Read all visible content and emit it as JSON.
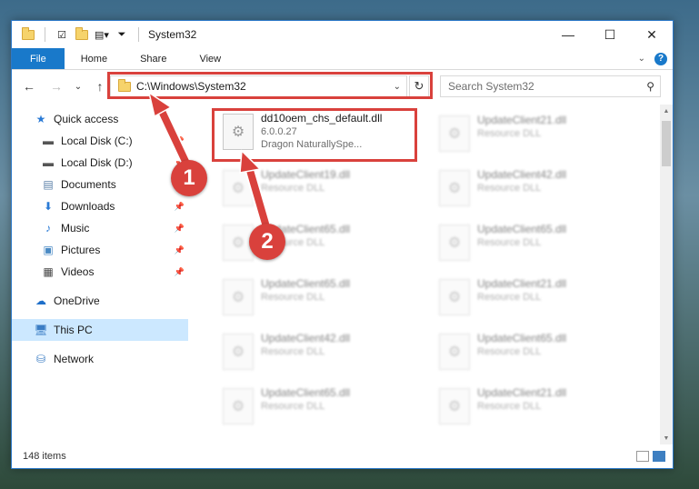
{
  "window": {
    "title": "System32",
    "controls": {
      "minimize": "—",
      "maximize": "☐",
      "close": "✕"
    }
  },
  "ribbon": {
    "tabs": [
      "File",
      "Home",
      "Share",
      "View"
    ],
    "help": "?"
  },
  "address": {
    "path": "C:\\Windows\\System32",
    "search_placeholder": "Search System32"
  },
  "sidebar": {
    "quick_access": "Quick access",
    "items": [
      {
        "label": "Local Disk (C:)",
        "icon": "drive-icon",
        "pinned": true
      },
      {
        "label": "Local Disk (D:)",
        "icon": "drive-icon",
        "pinned": true
      },
      {
        "label": "Documents",
        "icon": "documents-icon",
        "pinned": true
      },
      {
        "label": "Downloads",
        "icon": "downloads-icon",
        "pinned": true
      },
      {
        "label": "Music",
        "icon": "music-icon",
        "pinned": true
      },
      {
        "label": "Pictures",
        "icon": "pictures-icon",
        "pinned": true
      },
      {
        "label": "Videos",
        "icon": "videos-icon",
        "pinned": true
      }
    ],
    "onedrive": "OneDrive",
    "this_pc": "This PC",
    "network": "Network"
  },
  "files": {
    "highlighted": {
      "name": "dd10oem_chs_default.dll",
      "version": "6.0.0.27",
      "description": "Dragon NaturallySpe..."
    },
    "blurred_type": "Resource DLL",
    "left_column": [
      "UpdateClient19.dll",
      "UpdateClient65.dll",
      "UpdateClient65.dll",
      "UpdateClient42.dll",
      "UpdateClient65.dll"
    ],
    "right_column": [
      "UpdateClient21.dll",
      "UpdateClient42.dll",
      "UpdateClient65.dll",
      "UpdateClient21.dll",
      "UpdateClient65.dll",
      "UpdateClient21.dll"
    ]
  },
  "status": {
    "item_count": "148 items"
  },
  "annotations": {
    "step1": "1",
    "step2": "2",
    "color": "#d9413c"
  }
}
